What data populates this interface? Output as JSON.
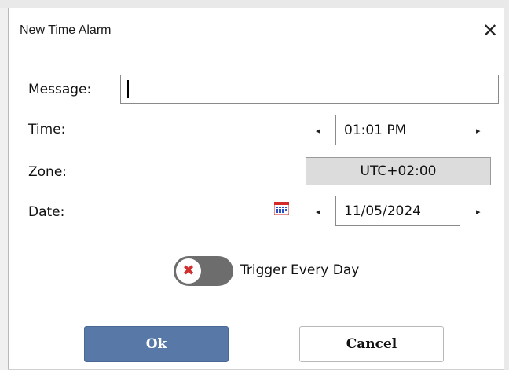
{
  "window": {
    "title": "New Time Alarm",
    "close_glyph": "✕"
  },
  "form": {
    "message_label": "Message:",
    "message_value": "",
    "time_label": "Time:",
    "time_value": "01:01 PM",
    "zone_label": "Zone:",
    "zone_value": "UTC+02:00",
    "date_label": "Date:",
    "date_value": "11/05/2024",
    "prev_arrow": "◂",
    "next_arrow": "▸"
  },
  "toggle": {
    "label": "Trigger Every Day",
    "checked": false,
    "off_glyph": "✖"
  },
  "buttons": {
    "ok_label": "Ok",
    "cancel_label": "Cancel"
  },
  "colors": {
    "primary_button": "#5878a8",
    "toggle_track_off": "#6d6d6d",
    "toggle_off_mark": "#d03030",
    "zone_background": "#dcdcdc"
  },
  "icons": {
    "calendar": "calendar-icon",
    "close": "close-icon"
  }
}
